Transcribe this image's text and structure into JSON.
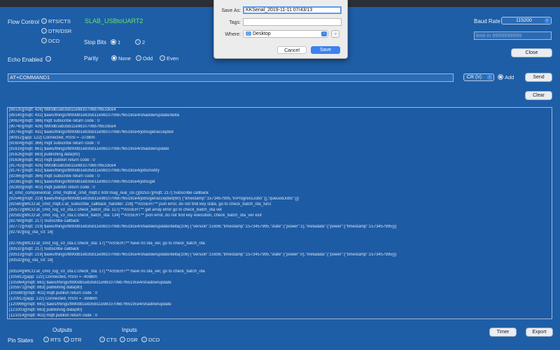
{
  "flow": {
    "label": "Flow Control",
    "options": [
      "RTS/CTS",
      "DTR/DSR",
      "DCD"
    ],
    "device": "SLAB_USBtoUART2"
  },
  "stop_bits": {
    "label": "Stop Bits",
    "options": [
      "1",
      "2"
    ],
    "selected": "1"
  },
  "echo": {
    "label": "Echo Enabled"
  },
  "parity": {
    "label": "Parity",
    "options": [
      "None",
      "Odd",
      "Even"
    ],
    "selected": "None"
  },
  "baud": {
    "label": "Baud Rate",
    "value": "115200"
  },
  "limit": {
    "placeholder": "limit in 9999999999"
  },
  "buttons": {
    "close": "Close",
    "send": "Send",
    "clear": "Clear",
    "timer": "Timer",
    "export": "Export"
  },
  "command": {
    "value": "AT+COMMAND1",
    "line_ending": "CR (\\r)",
    "add_label": "Add"
  },
  "log_lines": [
    "[89135][mqtt: 426] f890db1eb35b11e9810706b7f6519ce4",
    "[89140][mqtt: 432] $aws/things/f890db1eb35b11e9810706b7f6519ce4/shadow/update/delta",
    "[90624][mqtt: 366] mqtt subscribe return code : 0",
    "[90740][mqtt: 426] f890db1eb35b11e9810706b7f6519ce4",
    "[90745][mqtt: 432] $aws/things/f890db1eb35b11e9810706b7f6519ce4/jobs/get/accepted",
    "[90912][app: 122] Connected, RSSI = -37dBm",
    "[91604][mqtt: 366] mqtt subscribe return code : 0",
    "[91619][mqtt: 661] $aws/things/f890db1eb35b11e9810706b7f6519ce4/shadow/update",
    "[91626][mqtt: 663] publishing data(80)",
    "[91636][mqtt: 402] mqtt publish return code : 0",
    "[91742][mqtt: 426] f890db1eb35b11e9810706b7f6519ce4",
    "[91747][mqtt: 432] $aws/things/f890db1eb35b11e9810706b7f6519ce4/jobs/notify",
    "[92365][mqtt: 366] mqtt subscribe return code : 0",
    "[92381][mqtt: 661] $aws/things/f890db1eb35b11e9810706b7f6519ce4/jobs/get",
    "[92393][mqtt: 402] mqtt publish return code : 0",
    "at_cmd_component/at_cmd_mqtt/at_cmd_mqtt.c 639 mag_real_cis ()[92537][mqtt: 217] Subscribe callback",
    "[92546][mqtt: 219] $aws/things/f890db1eb35b11e9810706b7f6519ce4/jobs/get/accepted(60) {\"timestamp\":1573457995,\"inProgressJobs\":[],\"queuedJobs\":[]}",
    "[92560][MICO:at_cmd_mqtt.c:at_subscribe_callback_handler: 228] **ASSERT** json error, do not find key state, go to check_batch_ota_func",
    "[92572][MICO:at_cmd_log_v3_ota.c:check_batch_ota: 117] **ASSERT** get array error go to check_batch_ota ver",
    "[92582][MICO:at_cmd_log_v3_ota.c:check_batch_ota: 134] **ASSERT** json error, do not find key execution, check_batch_ota_ver exit",
    "[92769][mqtt: 217] Subscribe callback",
    "[92772][mqtt: 219] $aws/things/f890db1eb35b11e9810706b7f6519ce4/shadow/update/delta(106) {\"version\":15936,\"timestamp\":1573457995,\"state\":{\"power\":1},\"metadata\":{\"power\":{\"timestamp\":1573457995}}}",
    "[92792][log_ota_v3:  18]",
    "",
    "[92795][MICO:at_cmd_log_v3_ota.c:check_ota:  17] **ASSERT** have no ota_ver, go to check_batch_ota",
    "[93510][mqtt: 217] Subscribe callback",
    "[93513][mqtt: 219] $aws/things/f890db1eb35b11e9810706b7f6519ce4/shadow/update/delta(106) {\"version\":15936,\"timestamp\":1573457995,\"state\":{\"power\":0},\"metadata\":{\"power\":{\"timestamp\":1573457995}}}",
    "[93532][log_ota_v3:  18]",
    "",
    "[93534][MICO:at_cmd_log_v3_ota.c:check_ota:  17] **ASSERT** have no ota_ver, go to check_batch_ota",
    "[105912][app: 122] Connected, RSSI = -40dBm",
    "[105964][mqtt: 661] $aws/things/f890db1eb35b11e9810706b7f6519ce4/shadow/update",
    "[105971][mqtt: 663] publishing data(80)",
    "[105980][mqtt: 402] mqtt publish return code : 0",
    "[120912][app: 122] Connected, RSSI = -39dBm",
    "[120996][mqtt: 661] $aws/things/f890db1eb35b11e9810706b7f6519ce4/shadow/update",
    "[121003][mqtt: 663] publishing data(80)",
    "[121014][mqtt: 402] mqtt publish return code : 0"
  ],
  "pin_states": {
    "label": "Pin States",
    "outputs_label": "Outputs",
    "inputs_label": "Inputs",
    "outputs": [
      "RTS",
      "DTR"
    ],
    "inputs": [
      "CTS",
      "DSR",
      "DCD"
    ]
  },
  "save_dialog": {
    "save_as_label": "Save As:",
    "filename": "KKSerial_2019-11-11 07/43/13",
    "tags_label": "Tags:",
    "where_label": "Where:",
    "where_value": "Desktop",
    "cancel": "Cancel",
    "save": "Save"
  },
  "colors": {
    "background": "#1e5ea6",
    "accent_green": "#67e36a",
    "dialog_primary": "#3b82f0"
  }
}
